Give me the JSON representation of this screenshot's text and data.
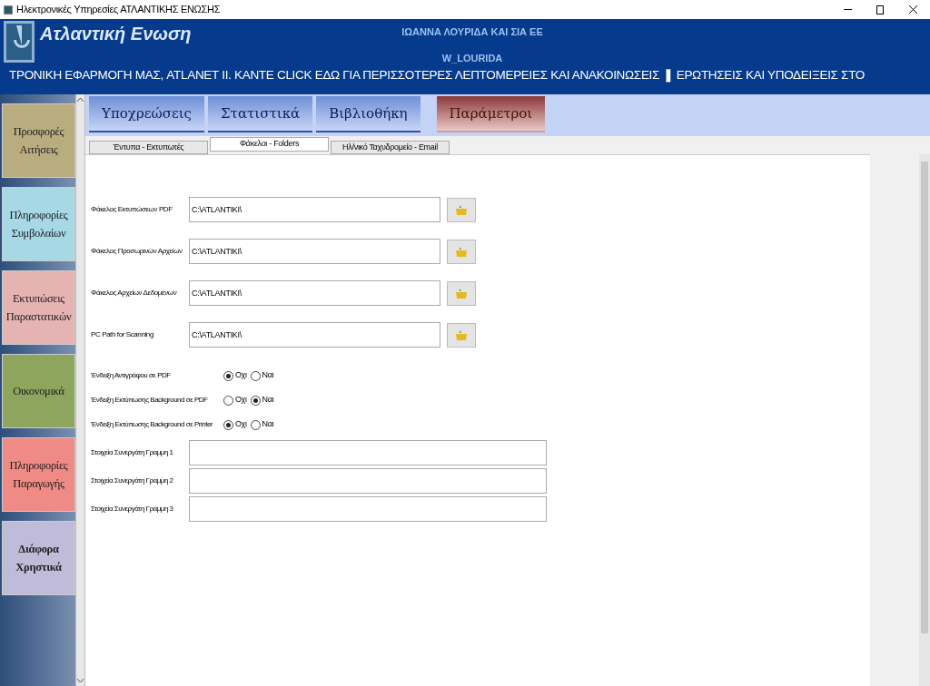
{
  "window": {
    "title": "Ηλεκτρονικές Υπηρεσίες ΑΤΛΑΝΤΙΚΗΣ ΕΝΩΣΗΣ"
  },
  "header": {
    "logo_text": "Ατλαντική Ενωση",
    "company": "ΙΩΑΝΝΑ ΛΟΥΡΙΔΑ ΚΑΙ ΣΙΑ ΕΕ",
    "user": "W_LOURIDA",
    "marquee": "ΤΡΟΝΙΚΗ ΕΦΑΡΜΟΓΗ ΜΑΣ, ATLANET II. ΚΑΝΤΕ CLICK ΕΔΩ ΓΙΑ ΠΕΡΙΣΣΟΤΕΡΕΣ ΛΕΠΤΟΜΕΡΕΙΕΣ ΚΑΙ ΑΝΑΚΟΙΝΩΣΕΙΣ ❚ ΕΡΩΤΗΣΕΙΣ ΚΑΙ ΥΠΟΔΕΙΞΕΙΣ ΣΤΟ"
  },
  "sidebar": {
    "items": [
      {
        "label": "Προσφορές Αιτήσεις",
        "color": "#b9ad80",
        "selected": false
      },
      {
        "label": "Πληροφορίες Συμβολαίων",
        "color": "#a6d8e6",
        "selected": false
      },
      {
        "label": "Εκτυπώσεις Παραστατικών",
        "color": "#e6b3b3",
        "selected": false
      },
      {
        "label": "Οικονομικά",
        "color": "#8ea55e",
        "selected": false
      },
      {
        "label": "Πληροφορίες Παραγωγής",
        "color": "#f08a84",
        "selected": false
      },
      {
        "label": "Διάφορα Χρηστικά",
        "color": "#bfbbd9",
        "selected": true
      }
    ]
  },
  "tabs": [
    {
      "label": "Υποχρεώσεις",
      "selected": false
    },
    {
      "label": "Στατιστικά",
      "selected": false
    },
    {
      "label": "Βιβλιοθήκη",
      "selected": false
    },
    {
      "label": "Παράμετροι",
      "selected": true
    }
  ],
  "subtabs": [
    {
      "label": "Έντυπα - Εκτυπωτές",
      "selected": false
    },
    {
      "label": "Φάκελοι - Folders",
      "selected": true
    },
    {
      "label": "Ηλ/νικό Ταχυδρομείο - Email",
      "selected": false
    }
  ],
  "folders": [
    {
      "label": "Φάκελος Εκτυπώσεων PDF",
      "value": "C:\\ATLANTIKI\\"
    },
    {
      "label": "Φάκελος Προσωρινών Αρχείων",
      "value": "C:\\ATLANTIKI\\"
    },
    {
      "label": "Φάκελος Αρχείων Δεδομένων",
      "value": "C:\\ATLANTIKI\\"
    },
    {
      "label": "PC Path for Scanning",
      "value": "C:\\ATLANTIKI\\"
    }
  ],
  "options": [
    {
      "label": "Ένδειξη Αντιγράφου σε PDF",
      "choices": [
        {
          "label": "Οχι",
          "selected": true
        },
        {
          "label": "Ναι",
          "selected": false
        }
      ]
    },
    {
      "label": "Ένδειξη Εκτύπωσης Background σε PDF",
      "choices": [
        {
          "label": "Οχι",
          "selected": false
        },
        {
          "label": "Ναι",
          "selected": true
        }
      ]
    },
    {
      "label": "Ένδειξη Εκτύπωσης Background σε Printer",
      "choices": [
        {
          "label": "Οχι",
          "selected": true
        },
        {
          "label": "Ναι",
          "selected": false
        }
      ]
    }
  ],
  "partner_lines": [
    {
      "label": "Στοιχεία Συνεργάτη Γραμμη 1"
    },
    {
      "label": "Στοιχεία Συνεργάτη Γραμμη 2"
    },
    {
      "label": "Στοιχεία Συνεργάτη Γραμμη 3"
    }
  ]
}
